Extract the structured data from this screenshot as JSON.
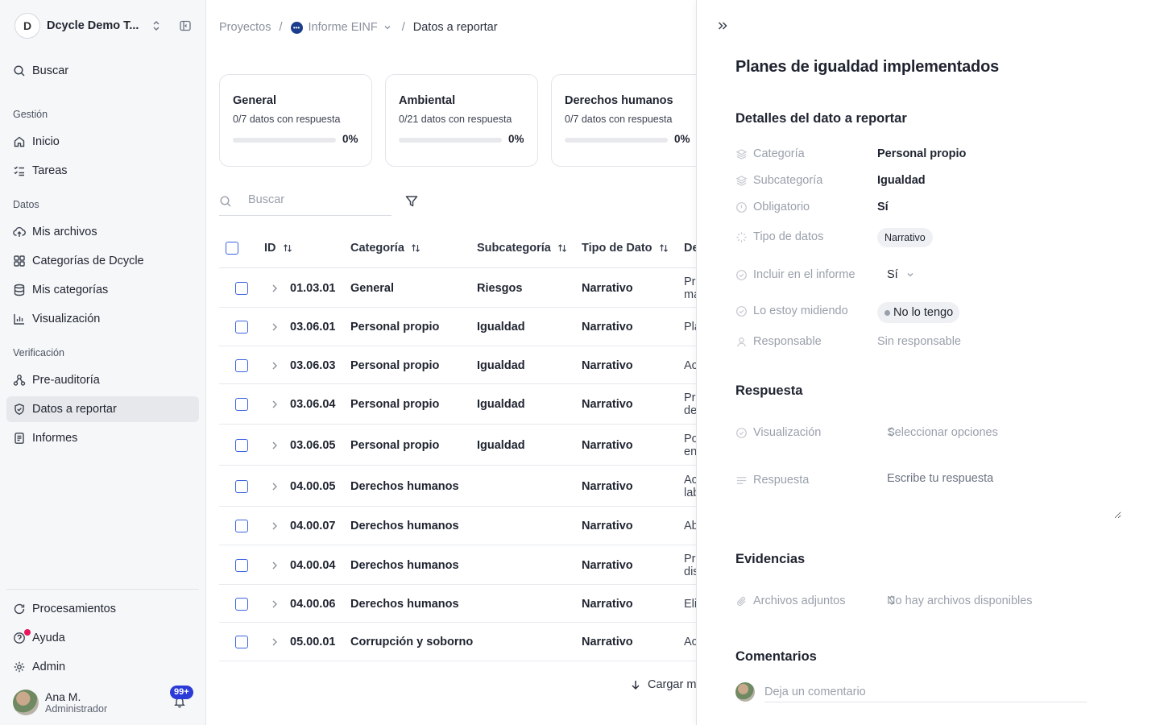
{
  "sidebar": {
    "workspace": {
      "initial": "D",
      "name": "Dcycle Demo T..."
    },
    "search_label": "Buscar",
    "sections": {
      "gestion": "Gestión",
      "datos": "Datos",
      "verificacion": "Verificación"
    },
    "items": {
      "inicio": "Inicio",
      "tareas": "Tareas",
      "mis_archivos": "Mis archivos",
      "categorias_dcycle": "Categorías de Dcycle",
      "mis_categorias": "Mis categorías",
      "visualizacion": "Visualización",
      "pre_auditoria": "Pre-auditoría",
      "datos_reportar": "Datos a reportar",
      "informes": "Informes",
      "procesamientos": "Procesamientos",
      "ayuda": "Ayuda",
      "admin": "Admin"
    },
    "user": {
      "name": "Ana M.",
      "role": "Administrador",
      "notifications": "99+"
    }
  },
  "breadcrumb": {
    "projects": "Proyectos",
    "report": "Informe EINF",
    "current": "Datos a reportar"
  },
  "summary_cards": [
    {
      "title": "General",
      "subtitle": "0/7 datos con respuesta",
      "percent": "0%",
      "progress": 0
    },
    {
      "title": "Ambiental",
      "subtitle": "0/21 datos con respuesta",
      "percent": "0%",
      "progress": 0
    },
    {
      "title": "Derechos humanos",
      "subtitle": "0/7 datos con respuesta",
      "percent": "0%",
      "progress": 0
    }
  ],
  "search": {
    "placeholder": "Buscar"
  },
  "table": {
    "headers": {
      "id": "ID",
      "categoria": "Categoría",
      "subcategoria": "Subcategoría",
      "tipo": "Tipo de Dato",
      "desc": "De"
    },
    "rows": [
      {
        "id": "01.03.01",
        "categoria": "General",
        "subcategoria": "Riesgos",
        "tipo": "Narrativo",
        "desc1": "Pri",
        "desc2": "ma"
      },
      {
        "id": "03.06.01",
        "categoria": "Personal propio",
        "subcategoria": "Igualdad",
        "tipo": "Narrativo",
        "desc1": "Pla",
        "desc2": ""
      },
      {
        "id": "03.06.03",
        "categoria": "Personal propio",
        "subcategoria": "Igualdad",
        "tipo": "Narrativo",
        "desc1": "Ac",
        "desc2": ""
      },
      {
        "id": "03.06.04",
        "categoria": "Personal propio",
        "subcategoria": "Igualdad",
        "tipo": "Narrativo",
        "desc1": "Pro",
        "desc2": "de"
      },
      {
        "id": "03.06.05",
        "categoria": "Personal propio",
        "subcategoria": "Igualdad",
        "tipo": "Narrativo",
        "desc1": "Po",
        "desc2": "en"
      },
      {
        "id": "04.00.05",
        "categoria": "Derechos humanos",
        "subcategoria": "",
        "tipo": "Narrativo",
        "desc1": "Ac",
        "desc2": "lab"
      },
      {
        "id": "04.00.07",
        "categoria": "Derechos humanos",
        "subcategoria": "",
        "tipo": "Narrativo",
        "desc1": "Ab",
        "desc2": ""
      },
      {
        "id": "04.00.04",
        "categoria": "Derechos humanos",
        "subcategoria": "",
        "tipo": "Narrativo",
        "desc1": "Pro",
        "desc2": "dis"
      },
      {
        "id": "04.00.06",
        "categoria": "Derechos humanos",
        "subcategoria": "",
        "tipo": "Narrativo",
        "desc1": "Eli",
        "desc2": ""
      },
      {
        "id": "05.00.01",
        "categoria": "Corrupción y soborno",
        "subcategoria": "",
        "tipo": "Narrativo",
        "desc1": "Ac",
        "desc2": ""
      }
    ],
    "load_more": "Cargar ma"
  },
  "panel": {
    "title": "Planes de igualdad implementados",
    "details_title": "Detalles del dato a reportar",
    "props": {
      "categoria": {
        "label": "Categoría",
        "value": "Personal propio"
      },
      "subcategoria": {
        "label": "Subcategoría",
        "value": "Igualdad"
      },
      "obligatorio": {
        "label": "Obligatorio",
        "value": "Sí"
      },
      "tipo": {
        "label": "Tipo de datos",
        "value": "Narrativo"
      },
      "incluir": {
        "label": "Incluir en el informe",
        "value": "Sí"
      },
      "midiendo": {
        "label": "Lo estoy midiendo",
        "value": "No lo tengo"
      },
      "responsable": {
        "label": "Responsable",
        "value": "Sin responsable"
      }
    },
    "respuesta_title": "Respuesta",
    "visualizacion": {
      "label": "Visualización",
      "placeholder": "Seleccionar opciones"
    },
    "respuesta": {
      "label": "Respuesta",
      "placeholder": "Escribe tu respuesta"
    },
    "evidencias_title": "Evidencias",
    "adjuntos": {
      "label": "Archivos adjuntos",
      "placeholder": "No hay archivos disponibles"
    },
    "comentarios_title": "Comentarios",
    "comment_placeholder": "Deja un comentario"
  },
  "colors": {
    "accent": "#2b3bd8",
    "checkbox": "#3b63e0",
    "notification_dot": "#e8175d"
  }
}
